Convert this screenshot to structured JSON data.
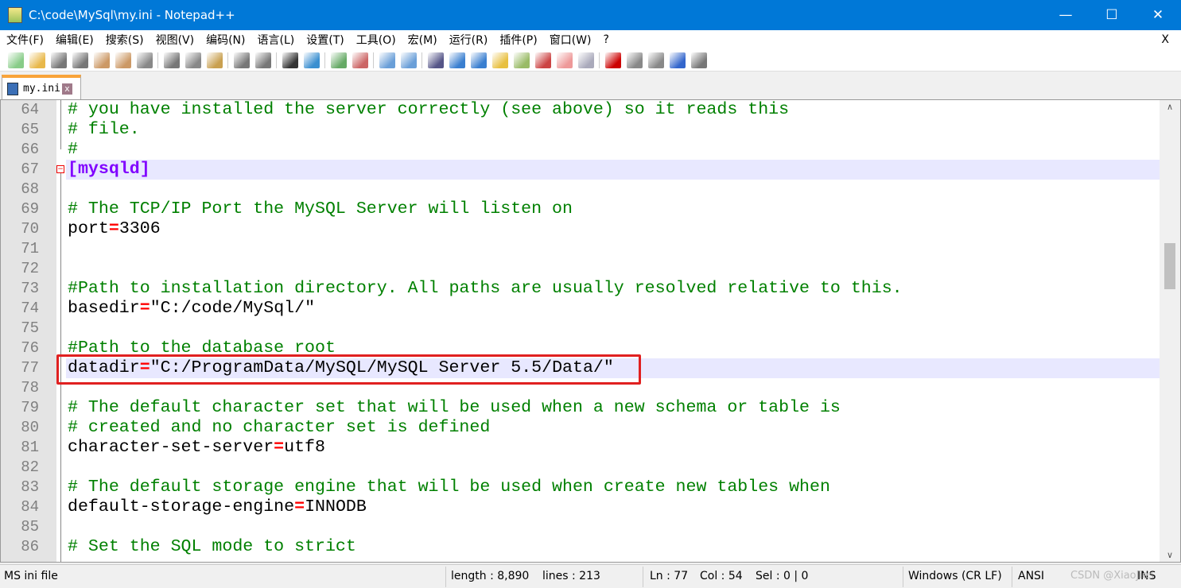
{
  "window": {
    "title": "C:\\code\\MySql\\my.ini - Notepad++",
    "minimize": "—",
    "maximize": "☐",
    "close": "✕"
  },
  "menu": [
    "文件(F)",
    "编辑(E)",
    "搜索(S)",
    "视图(V)",
    "编码(N)",
    "语言(L)",
    "设置(T)",
    "工具(O)",
    "宏(M)",
    "运行(R)",
    "插件(P)",
    "窗口(W)",
    "?"
  ],
  "menu_close": "X",
  "tab": {
    "label": "my.ini",
    "close": "x"
  },
  "lines": [
    {
      "n": "64",
      "parts": [
        [
          "c",
          "# you have installed the server correctly (see above) so it reads this"
        ]
      ]
    },
    {
      "n": "65",
      "parts": [
        [
          "c",
          "# file."
        ]
      ]
    },
    {
      "n": "66",
      "parts": [
        [
          "c",
          "#"
        ]
      ]
    },
    {
      "n": "67",
      "parts": [
        [
          "s",
          "[mysqld]"
        ]
      ],
      "hl": true
    },
    {
      "n": "68",
      "parts": []
    },
    {
      "n": "69",
      "parts": [
        [
          "c",
          "# The TCP/IP Port the MySQL Server will listen on"
        ]
      ]
    },
    {
      "n": "70",
      "parts": [
        [
          "k",
          "port"
        ],
        [
          "o",
          "="
        ],
        [
          "k",
          "3306"
        ]
      ]
    },
    {
      "n": "71",
      "parts": []
    },
    {
      "n": "72",
      "parts": []
    },
    {
      "n": "73",
      "parts": [
        [
          "c",
          "#Path to installation directory. All paths are usually resolved relative to this."
        ]
      ]
    },
    {
      "n": "74",
      "parts": [
        [
          "k",
          "basedir"
        ],
        [
          "o",
          "="
        ],
        [
          "k",
          "\"C:/code/MySql/\""
        ]
      ]
    },
    {
      "n": "75",
      "parts": []
    },
    {
      "n": "76",
      "parts": [
        [
          "c",
          "#Path to the database root"
        ]
      ]
    },
    {
      "n": "77",
      "parts": [
        [
          "k",
          "datadir"
        ],
        [
          "o",
          "="
        ],
        [
          "k",
          "\"C:/ProgramData/MySQL/MySQL Server 5.5/Data/\""
        ]
      ],
      "hl": true
    },
    {
      "n": "78",
      "parts": []
    },
    {
      "n": "79",
      "parts": [
        [
          "c",
          "# The default character set that will be used when a new schema or table is"
        ]
      ]
    },
    {
      "n": "80",
      "parts": [
        [
          "c",
          "# created and no character set is defined"
        ]
      ]
    },
    {
      "n": "81",
      "parts": [
        [
          "k",
          "character-set-server"
        ],
        [
          "o",
          "="
        ],
        [
          "k",
          "utf8"
        ]
      ]
    },
    {
      "n": "82",
      "parts": []
    },
    {
      "n": "83",
      "parts": [
        [
          "c",
          "# The default storage engine that will be used when create new tables when"
        ]
      ]
    },
    {
      "n": "84",
      "parts": [
        [
          "k",
          "default-storage-engine"
        ],
        [
          "o",
          "="
        ],
        [
          "k",
          "INNODB"
        ]
      ]
    },
    {
      "n": "85",
      "parts": []
    },
    {
      "n": "86",
      "parts": [
        [
          "c",
          "# Set the SQL mode to strict"
        ]
      ]
    }
  ],
  "status": {
    "lang": "MS ini file",
    "length": "length : 8,890",
    "lines": "lines : 213",
    "ln": "Ln : 77",
    "col": "Col : 54",
    "sel": "Sel : 0 | 0",
    "eol": "Windows (CR LF)",
    "enc": "ANSI",
    "mode": "INS",
    "watermark": "CSDN @XiaoJies"
  }
}
